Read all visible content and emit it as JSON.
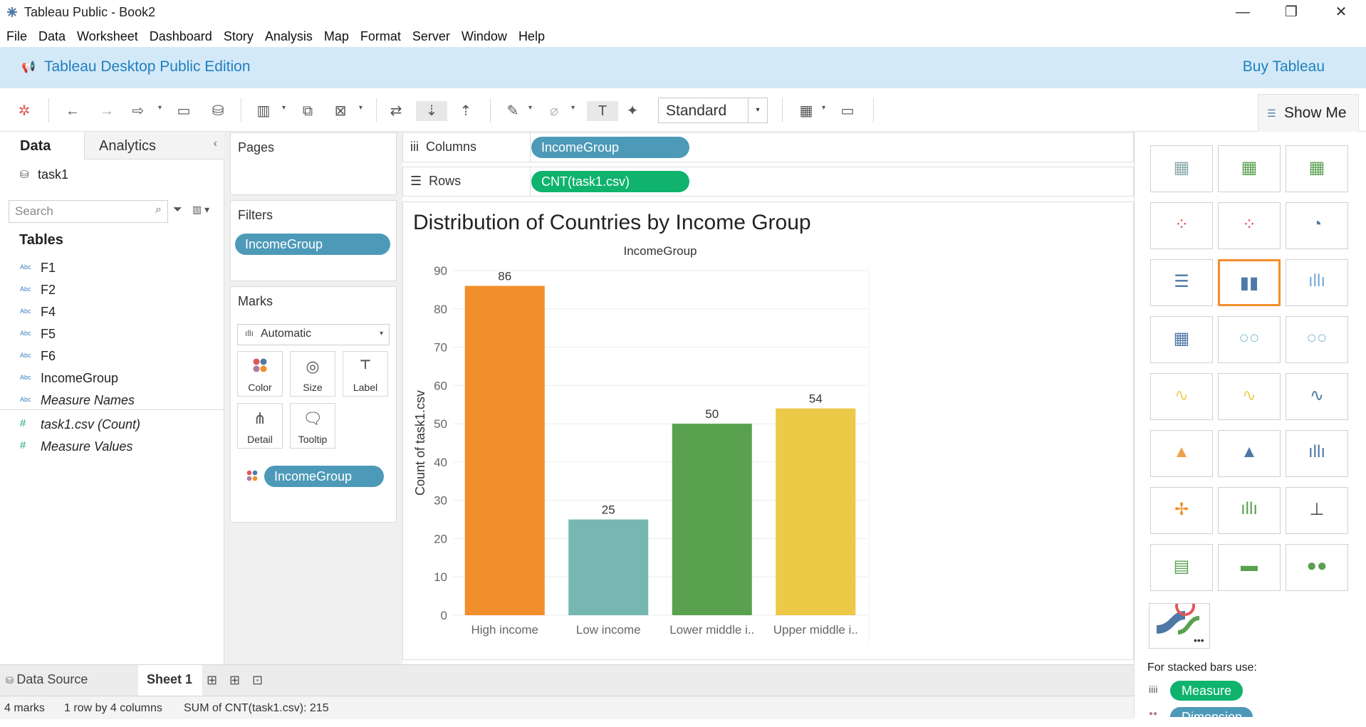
{
  "window": {
    "title": "Tableau Public - Book2"
  },
  "menu": [
    "File",
    "Data",
    "Worksheet",
    "Dashboard",
    "Story",
    "Analysis",
    "Map",
    "Format",
    "Server",
    "Window",
    "Help"
  ],
  "banner": {
    "edition": "Tableau Desktop Public Edition",
    "buy": "Buy Tableau"
  },
  "toolbar": {
    "fit": "Standard",
    "show_me": "Show Me"
  },
  "data_pane": {
    "tab_data": "Data",
    "tab_analytics": "Analytics",
    "datasource": "task1",
    "search_placeholder": "Search",
    "tables_heading": "Tables",
    "dimensions": [
      "F1",
      "F2",
      "F4",
      "F5",
      "F6",
      "IncomeGroup",
      "Measure Names"
    ],
    "measures": [
      "task1.csv (Count)",
      "Measure Values"
    ]
  },
  "cards": {
    "pages": "Pages",
    "filters": "Filters",
    "filter_pill": "IncomeGroup",
    "marks": "Marks",
    "mark_type": "Automatic",
    "buttons": [
      "Color",
      "Size",
      "Label",
      "Detail",
      "Tooltip"
    ],
    "color_pill": "IncomeGroup"
  },
  "shelves": {
    "columns_label": "Columns",
    "columns_pill": "IncomeGroup",
    "rows_label": "Rows",
    "rows_pill": "CNT(task1.csv)"
  },
  "chart_data": {
    "type": "bar",
    "title": "Distribution of Countries by Income Group",
    "header": "IncomeGroup",
    "ylabel": "Count of task1.csv",
    "categories": [
      "High income",
      "Low income",
      "Lower middle i..",
      "Upper middle i.."
    ],
    "values": [
      86,
      25,
      50,
      54
    ],
    "colors": [
      "#f28e2b",
      "#76b7b2",
      "#59a14f",
      "#edc948"
    ],
    "ylim": [
      0,
      90
    ],
    "yticks": [
      0,
      10,
      20,
      30,
      40,
      50,
      60,
      70,
      80,
      90
    ],
    "grid": true
  },
  "show_me": {
    "hint": "For stacked bars use:",
    "measure": "Measure",
    "dimension": "Dimension"
  },
  "tabs": {
    "data_source": "Data Source",
    "sheet": "Sheet 1"
  },
  "status": {
    "marks": "4 marks",
    "dims": "1 row by 4 columns",
    "sum": "SUM of CNT(task1.csv): 215"
  }
}
